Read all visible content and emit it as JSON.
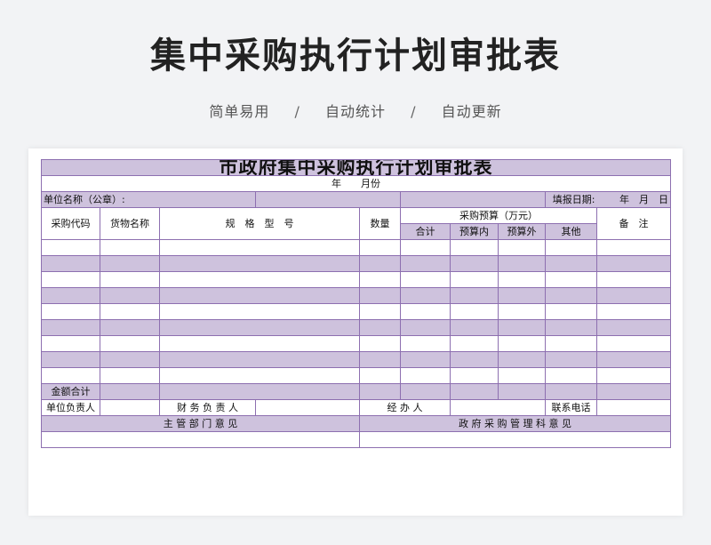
{
  "header": {
    "title": "集中采购执行计划审批表",
    "tags": [
      "简单易用",
      "自动统计",
      "自动更新"
    ],
    "separator": "/"
  },
  "form": {
    "title": "市政府集中采购执行计划审批表",
    "year_month": "年　　月份",
    "unit_name_label": "单位名称（公章）:",
    "fill_date_label": "填报日期:",
    "fill_date_value": "年　月　日",
    "columns": {
      "code": "采购代码",
      "goods_name": "货物名称",
      "spec": "规　格　型　号",
      "quantity": "数量",
      "budget": "采购预算（万元）",
      "budget_total": "合计",
      "budget_in": "预算内",
      "budget_out": "预算外",
      "budget_other": "其他",
      "remark": "备　注"
    },
    "total_label": "金额合计",
    "unit_head_label": "单位负责人",
    "finance_head_label": "财 务 负 责 人",
    "handler_label": "经 办 人",
    "phone_label": "联系电话",
    "dept_opinion_label": "主 管 部 门 意 见",
    "gov_opinion_label": "政 府 采 购 管 理 科 意 见"
  }
}
